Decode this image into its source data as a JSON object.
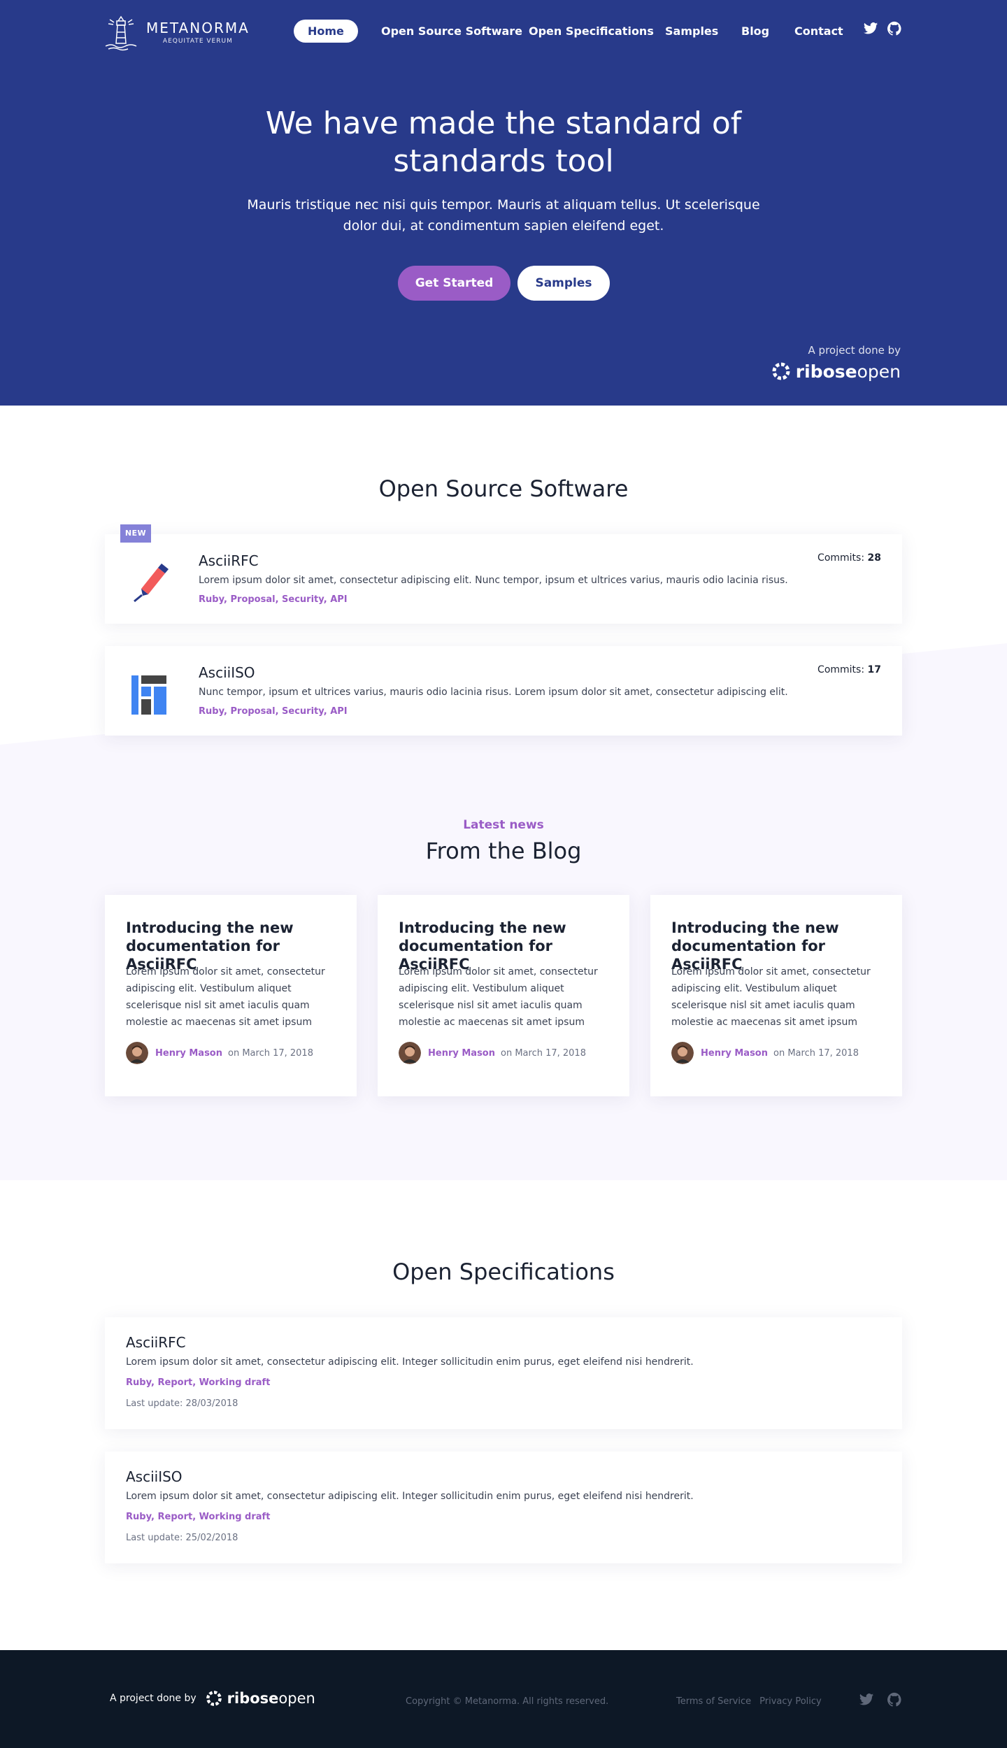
{
  "brand": {
    "name": "METANORMA",
    "tagline": "AEQUITATE VERUM"
  },
  "nav": {
    "items": [
      {
        "label": "Home",
        "active": true
      },
      {
        "label": "Open Source Software",
        "active": false
      },
      {
        "label": "Open Specifications",
        "active": false
      },
      {
        "label": "Samples",
        "active": false
      },
      {
        "label": "Blog",
        "active": false
      },
      {
        "label": "Contact",
        "active": false
      }
    ],
    "social": [
      "twitter-icon",
      "github-icon"
    ]
  },
  "hero": {
    "title_line1": "We have made the standard of",
    "title_line2": "standards tool",
    "subtitle": "Mauris tristique nec nisi quis tempor. Mauris at aliquam tellus. Ut scelerisque dolor dui, at condimentum sapien eleifend eget.",
    "cta_primary": "Get Started",
    "cta_secondary": "Samples",
    "project_label": "A project done by",
    "project_brand_bold": "ribose",
    "project_brand_light": "open"
  },
  "software": {
    "title": "Open Source Software",
    "new_badge": "NEW",
    "items": [
      {
        "name": "AsciiRFC",
        "description": "Lorem ipsum dolor sit amet, consectetur adipiscing elit. Nunc tempor, ipsum et ultrices varius, mauris odio lacinia risus.",
        "tags": "Ruby, Proposal, Security, API",
        "commits_label": "Commits:",
        "commits": "28",
        "icon": "pen-icon"
      },
      {
        "name": "AsciiISO",
        "description": "Nunc tempor, ipsum et ultrices varius, mauris odio lacinia risus. Lorem ipsum dolor sit amet, consectetur adipiscing elit.",
        "tags": "Ruby, Proposal, Security, API",
        "commits_label": "Commits:",
        "commits": "17",
        "icon": "iso-layout-icon"
      }
    ]
  },
  "blog": {
    "eyebrow": "Latest news",
    "title": "From the Blog",
    "posts": [
      {
        "title": "Introducing the new documentation for AsciiRFC",
        "excerpt": "Lorem ipsum dolor sit amet, consectetur adipiscing elit. Vestibulum aliquet scelerisque nisl sit amet iaculis quam molestie ac maecenas sit amet ipsum",
        "author": "Henry Mason",
        "date": "on March 17, 2018"
      },
      {
        "title": "Introducing the new documentation for AsciiRFC",
        "excerpt": "Lorem ipsum dolor sit amet, consectetur adipiscing elit. Vestibulum aliquet scelerisque nisl sit amet iaculis quam molestie ac maecenas sit amet ipsum",
        "author": "Henry Mason",
        "date": "on March 17, 2018"
      },
      {
        "title": "Introducing the new documentation for AsciiRFC",
        "excerpt": "Lorem ipsum dolor sit amet, consectetur adipiscing elit. Vestibulum aliquet scelerisque nisl sit amet iaculis quam molestie ac maecenas sit amet ipsum",
        "author": "Henry Mason",
        "date": "on March 17, 2018"
      }
    ]
  },
  "specs": {
    "title": "Open Specifications",
    "items": [
      {
        "name": "AsciiRFC",
        "description": "Lorem ipsum dolor sit amet, consectetur adipiscing elit. Integer sollicitudin enim purus, eget eleifend nisi hendrerit.",
        "tags": "Ruby, Report, Working draft",
        "updated": "Last update: 28/03/2018"
      },
      {
        "name": "AsciiISO",
        "description": "Lorem ipsum dolor sit amet, consectetur adipiscing elit. Integer sollicitudin enim purus, eget eleifend nisi hendrerit.",
        "tags": "Ruby, Report, Working draft",
        "updated": "Last update: 25/02/2018"
      }
    ]
  },
  "footer": {
    "project_label": "A project done by",
    "brand_bold": "ribose",
    "brand_light": "open",
    "copyright": "Copyright © Metanorma. All rights reserved.",
    "links": [
      "Terms of Service",
      "Privacy Policy"
    ]
  },
  "colors": {
    "hero_bg": "#283a8a",
    "accent": "#9a5cc6",
    "badge": "#8481d8",
    "footer_bg": "#0d1826",
    "band_bg": "#f9f7fe"
  }
}
